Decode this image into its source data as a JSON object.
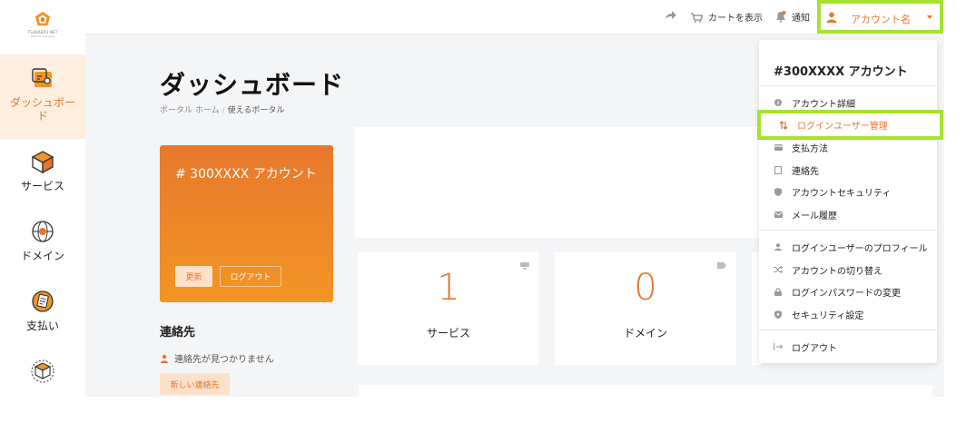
{
  "brand": {
    "logo_text": "TSUKAERU.NET",
    "logo_sub": "Web for everyone",
    "accent": "#e8752a",
    "highlight": "#a6e22e"
  },
  "sidebar": {
    "items": [
      {
        "label": "ダッシュボード",
        "icon": "dashboard-icon",
        "active": true
      },
      {
        "label": "サービス",
        "icon": "box-icon",
        "active": false
      },
      {
        "label": "ドメイン",
        "icon": "globe-icon",
        "active": false
      },
      {
        "label": "支払い",
        "icon": "receipt-icon",
        "active": false
      },
      {
        "label": "",
        "icon": "package-icon",
        "active": false
      }
    ]
  },
  "topbar": {
    "share_icon": "share-icon",
    "cart_label": "カートを表示",
    "notify_label": "通知",
    "account_label": "アカウント名"
  },
  "page": {
    "title": "ダッシュボード",
    "breadcrumb": [
      "ポータル ホーム",
      "使えるポータル"
    ]
  },
  "account_card": {
    "title": "# 300XXXX  アカウント",
    "refresh_label": "更新",
    "logout_label": "ログアウト"
  },
  "contacts": {
    "title": "連絡先",
    "empty_text": "連絡先が見つかりません",
    "new_button": "新しい連絡先"
  },
  "stats": [
    {
      "value": "1",
      "label": "サービス",
      "icon": "server-icon"
    },
    {
      "value": "0",
      "label": "ドメイン",
      "icon": "tag-icon"
    }
  ],
  "dropdown": {
    "title": "#300XXXX  アカウント",
    "group1": [
      {
        "label": "アカウント詳細",
        "icon": "info-icon"
      },
      {
        "label": "ログインユーザー管理",
        "icon": "swap-icon",
        "highlight": true
      },
      {
        "label": "支払方法",
        "icon": "card-icon"
      },
      {
        "label": "連絡先",
        "icon": "contact-icon"
      },
      {
        "label": "アカウントセキュリティ",
        "icon": "shield-icon"
      },
      {
        "label": "メール履歴",
        "icon": "mail-icon"
      }
    ],
    "group2": [
      {
        "label": "ログインユーザーのプロフィール",
        "icon": "user-icon"
      },
      {
        "label": "アカウントの切り替え",
        "icon": "shuffle-icon"
      },
      {
        "label": "ログインパスワードの変更",
        "icon": "lock-icon"
      },
      {
        "label": "セキュリティ設定",
        "icon": "shield-check-icon"
      }
    ],
    "group3": [
      {
        "label": "ログアウト",
        "icon": "logout-icon"
      }
    ]
  }
}
